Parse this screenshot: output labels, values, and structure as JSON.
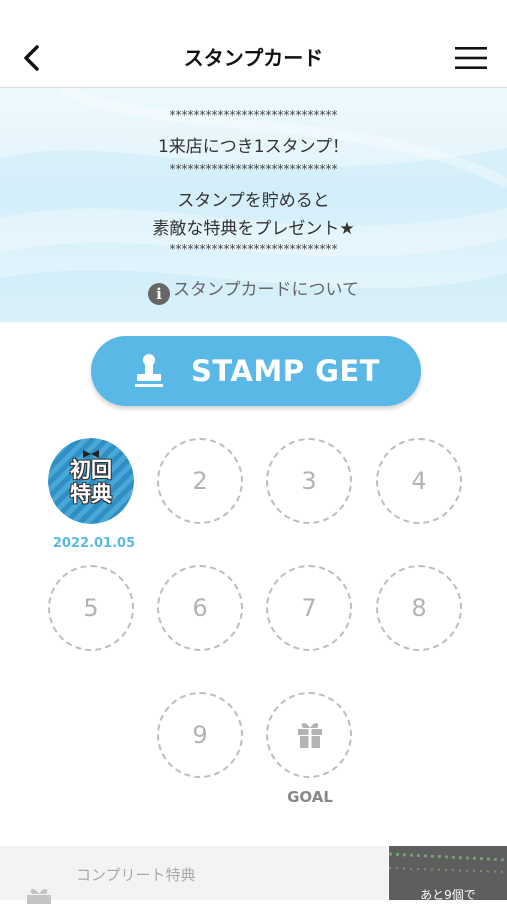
{
  "header": {
    "title": "スタンプカード"
  },
  "banner": {
    "stars": "****************************",
    "line1": "1来店につき1スタンプ！",
    "line2": "スタンプを貯めると",
    "line3": "素敵な特典をプレゼント★",
    "info_link": "スタンプカードについて"
  },
  "stamp_button": {
    "label": "STAMP GET"
  },
  "stamps": {
    "first": {
      "label_top": "初回",
      "label_bottom": "特典",
      "date": "2022.01.05"
    },
    "slots": [
      "2",
      "3",
      "4",
      "5",
      "6",
      "7",
      "8",
      "9"
    ],
    "goal_label": "GOAL"
  },
  "footer": {
    "title": "コンプリート特典",
    "thumb_text": "あと9個で"
  },
  "colors": {
    "accent": "#5ab8e6",
    "banner": "#d9f1fb",
    "slot_border": "#bdbdbd"
  }
}
